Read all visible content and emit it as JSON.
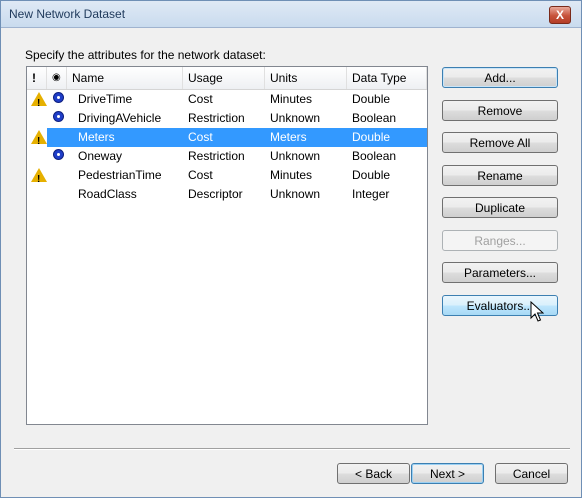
{
  "window": {
    "title": "New Network Dataset",
    "close_label": "X"
  },
  "instruction": "Specify the attributes for the network dataset:",
  "columns": {
    "warn": "!",
    "use": "◉",
    "name": "Name",
    "usage": "Usage",
    "units": "Units",
    "data_type": "Data Type"
  },
  "rows": [
    {
      "name": "DriveTime",
      "usage": "Cost",
      "units": "Minutes",
      "data_type": "Double",
      "warning": true,
      "default": true,
      "selected": false
    },
    {
      "name": "DrivingAVehicle",
      "usage": "Restriction",
      "units": "Unknown",
      "data_type": "Boolean",
      "warning": false,
      "default": true,
      "selected": false
    },
    {
      "name": "Meters",
      "usage": "Cost",
      "units": "Meters",
      "data_type": "Double",
      "warning": true,
      "default": false,
      "selected": true
    },
    {
      "name": "Oneway",
      "usage": "Restriction",
      "units": "Unknown",
      "data_type": "Boolean",
      "warning": false,
      "default": true,
      "selected": false
    },
    {
      "name": "PedestrianTime",
      "usage": "Cost",
      "units": "Minutes",
      "data_type": "Double",
      "warning": true,
      "default": false,
      "selected": false
    },
    {
      "name": "RoadClass",
      "usage": "Descriptor",
      "units": "Unknown",
      "data_type": "Integer",
      "warning": false,
      "default": false,
      "selected": false
    }
  ],
  "side_buttons": {
    "add": "Add...",
    "remove": "Remove",
    "remove_all": "Remove All",
    "rename": "Rename",
    "duplicate": "Duplicate",
    "ranges": "Ranges...",
    "parameters": "Parameters...",
    "evaluators": "Evaluators..."
  },
  "footer": {
    "back": "< Back",
    "next": "Next >",
    "cancel": "Cancel"
  },
  "icons": {
    "warning": "warning-icon",
    "default_attr": "default-attribute-icon",
    "cursor": "mouse-pointer-icon"
  },
  "colors": {
    "selection": "#3399ff",
    "warning": "#e6b000",
    "default_dot": "#1f3ec8"
  }
}
